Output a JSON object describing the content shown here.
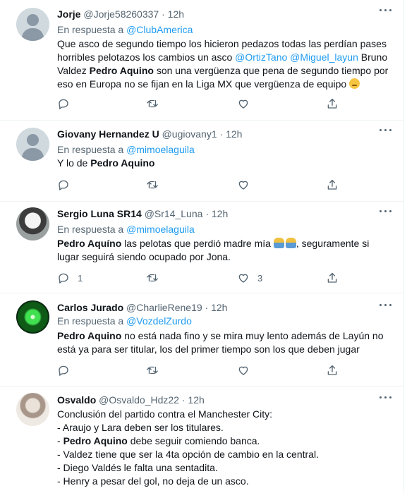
{
  "tweets": [
    {
      "name": "Jorje",
      "handle": "@Jorje58260337",
      "dot": "·",
      "time": "12h",
      "reply_prefix": "En respuesta a",
      "reply_to": "@ClubAmerica",
      "text": {
        "l1": "Que asco de segundo tiempo los hicieron pedazos todas las perdían pases",
        "l2a": "horribles pelotazos los cambios un asco",
        "m1": "@OrtizTano",
        "m2": "@Miguel_layun",
        "l2b": "Bruno",
        "l3a": "Valdez",
        "b1": "Pedro Aquino",
        "l3b": "son una vergüenza que pena de segundo tiempo por",
        "l4": "eso en Europa no se fijan en la Liga MX que vergüenza de equipo"
      },
      "emoji": "sad-face-emoji",
      "reply_count": "",
      "like_count": ""
    },
    {
      "name": "Giovany Hernandez U",
      "handle": "@ugiovany1",
      "dot": "·",
      "time": "12h",
      "reply_prefix": "En respuesta a",
      "reply_to": "@mimoelaguila",
      "text": {
        "a": "Y lo de",
        "b1": "Pedro Aquino"
      },
      "reply_count": "",
      "like_count": ""
    },
    {
      "name": "Sergio Luna SR14",
      "handle": "@Sr14_Luna",
      "dot": "·",
      "time": "12h",
      "reply_prefix": "En respuesta a",
      "reply_to": "@mimoelaguila",
      "text": {
        "b1": "Pedro Aquíno",
        "l1a": "las pelotas que perdió madre mía",
        "l1b": ", seguramente si",
        "l2": "lugar seguirá siendo ocupado por Jona."
      },
      "emoji": "person-facepalming-emoji",
      "reply_count": "1",
      "like_count": "3"
    },
    {
      "name": "Carlos Jurado",
      "handle": "@CharlieRene19",
      "dot": "·",
      "time": "12h",
      "reply_prefix": "En respuesta a",
      "reply_to": "@VozdelZurdo",
      "text": {
        "b1": "Pedro Aquino",
        "l1": "no está nada fino y se mira muy lento además de Layún no",
        "l2": "está ya para ser titular, los del primer tiempo son los que deben jugar"
      },
      "reply_count": "",
      "like_count": ""
    },
    {
      "name": "Osvaldo",
      "handle": "@Osvaldo_Hdz22",
      "dot": "·",
      "time": "12h",
      "text": {
        "l1": "Conclusión del partido contra el Manchester City:",
        "l2": "- Araujo y Lara deben ser los titulares.",
        "l3a": "-",
        "b1": "Pedro Aquino",
        "l3b": "debe seguir comiendo banca.",
        "l4": "- Valdez tiene que ser la 4ta opción de cambio en la central.",
        "l5": "- Diego Valdés le falta una sentadita.",
        "l6": "- Henry a pesar del gol, no deja de un asco."
      }
    }
  ],
  "colors": {
    "link": "#1d9bf0",
    "muted": "#536471",
    "text": "#0f1419",
    "divider": "#eff3f4"
  },
  "icons": [
    "more-icon",
    "reply-icon",
    "retweet-icon",
    "like-icon",
    "share-icon"
  ]
}
